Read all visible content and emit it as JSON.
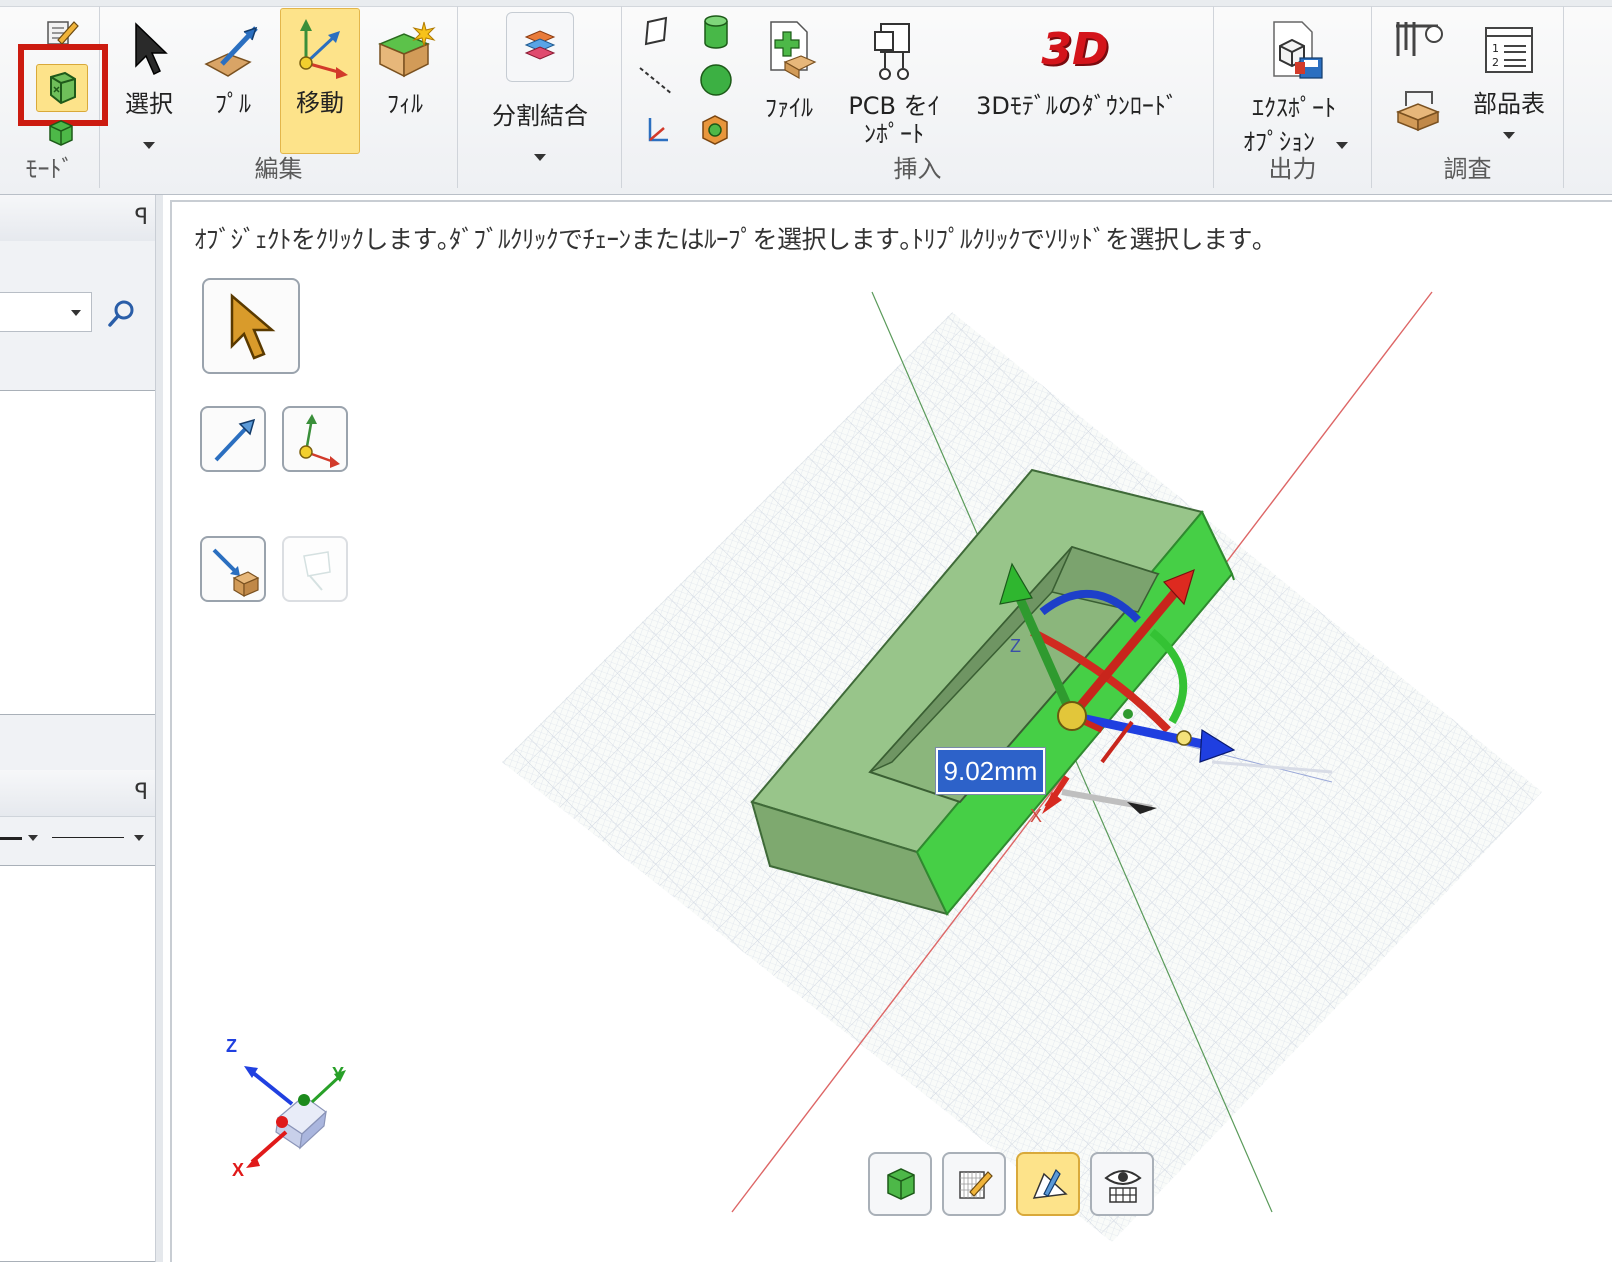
{
  "ribbon": {
    "mode_group": {
      "label": "ﾓｰﾄﾞ"
    },
    "edit_group": {
      "label": "編集",
      "select": "選択",
      "pull": "ﾌﾟﾙ",
      "move": "移動",
      "fill": "ﾌｨﾙ"
    },
    "combine_group": {
      "split_combine": "分割結合"
    },
    "insert_group": {
      "label": "挿入",
      "file": "ﾌｧｲﾙ",
      "pcb_import_line1": "PCB をｲ",
      "pcb_import_line2": "ﾝﾎﾟｰﾄ",
      "download_3d": "3Dﾓﾃﾞﾙのﾀﾞｳﾝﾛｰﾄﾞ",
      "logo_3d": "3D"
    },
    "output_group": {
      "label": "出力",
      "export_line1": "ｴｸｽﾎﾟｰﾄ",
      "export_line2": "ｵﾌﾟｼｮﾝ"
    },
    "investigate_group": {
      "label": "調査",
      "bom": "部品表"
    }
  },
  "left_panel": {
    "pin_glyph": "ꟼ",
    "search_icon": "search-icon"
  },
  "viewport": {
    "hint": "ｵﾌﾞｼﾞｪｸﾄをｸﾘｯｸします｡ﾀﾞﾌﾞﾙｸﾘｯｸでﾁｪｰﾝまたはﾙｰﾌﾟを選択します｡ﾄﾘﾌﾟﾙｸﾘｯｸでｿﾘｯﾄﾞを選択します｡",
    "measurement": "9.02mm",
    "triad": {
      "z": "Z",
      "y": "Y",
      "x": "X"
    },
    "handle_z": "Z",
    "handle_x": "X"
  },
  "colors": {
    "highlight": "#cc1b10",
    "active": "#fde38a",
    "solid": "#8fbf82",
    "selected_face": "#3fcf3f"
  }
}
